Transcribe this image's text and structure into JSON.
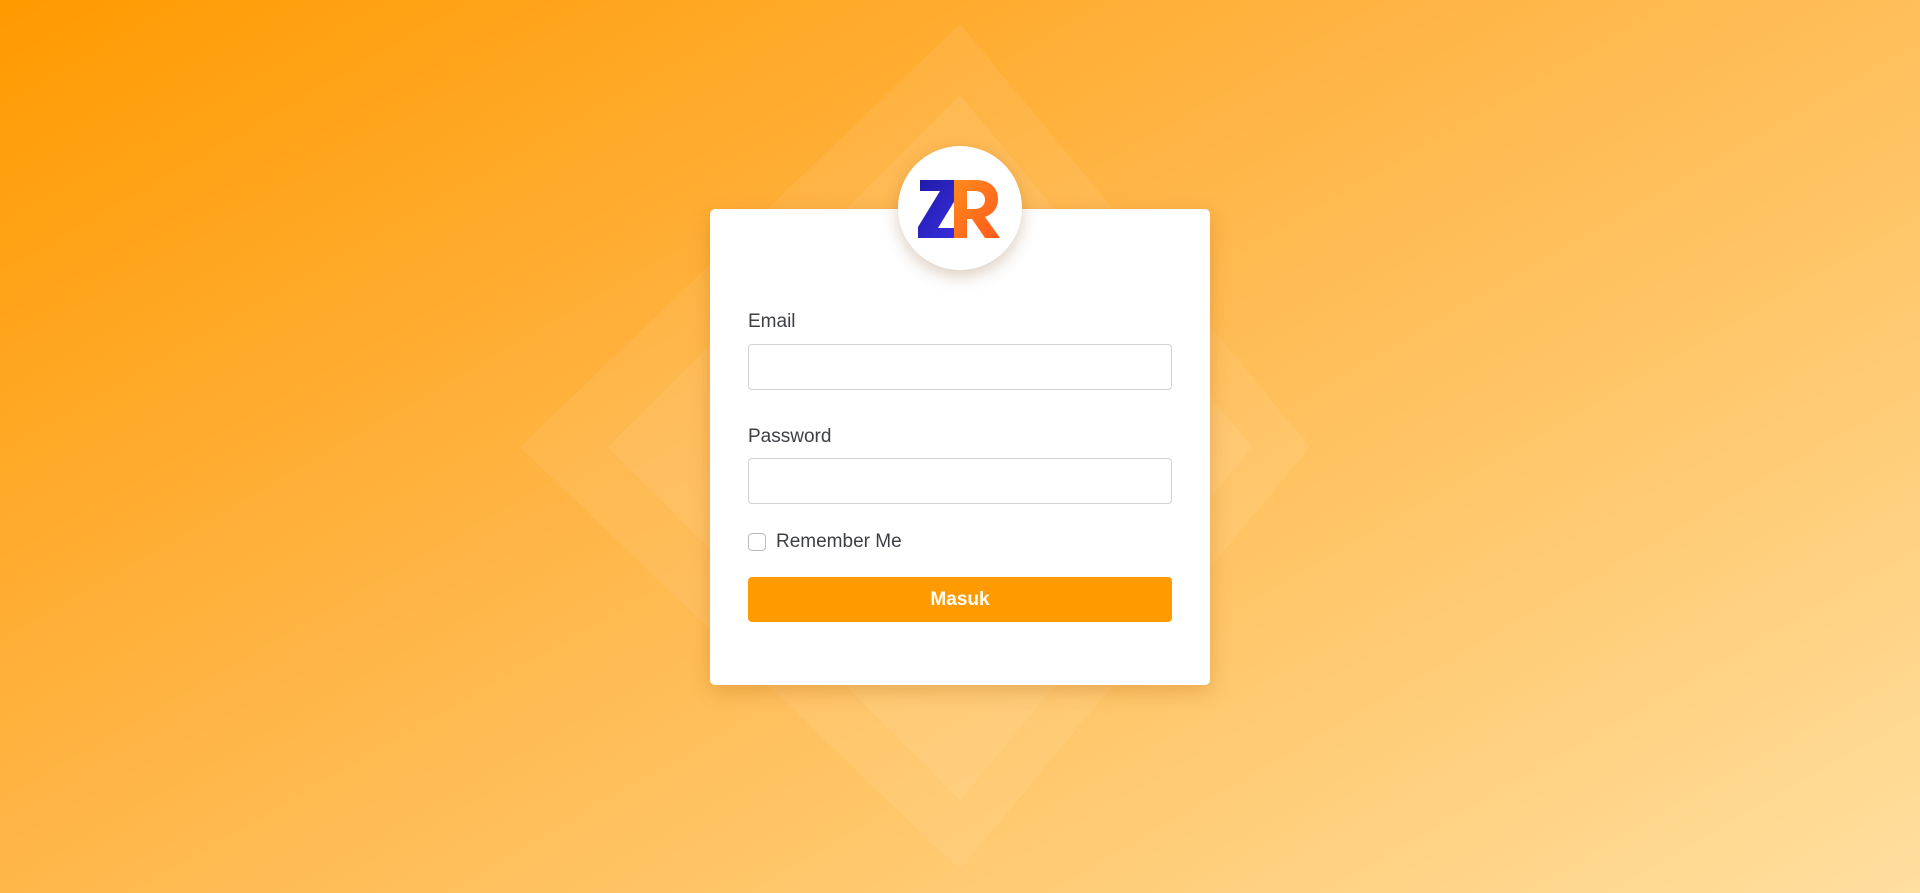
{
  "brand": {
    "logo_text": "ZR",
    "logo_letter_1": "Z",
    "logo_letter_2": "R"
  },
  "form": {
    "email_label": "Email",
    "email_value": "",
    "email_placeholder": "",
    "password_label": "Password",
    "password_value": "",
    "password_placeholder": "",
    "remember_label": "Remember Me",
    "remember_checked": false,
    "submit_label": "Masuk"
  },
  "colors": {
    "accent": "#ff9a00",
    "background_start": "#ff9a00",
    "background_end": "#ffdf9f",
    "logo_blue": "#2a1fc0",
    "logo_orange": "#ff6a1a"
  }
}
